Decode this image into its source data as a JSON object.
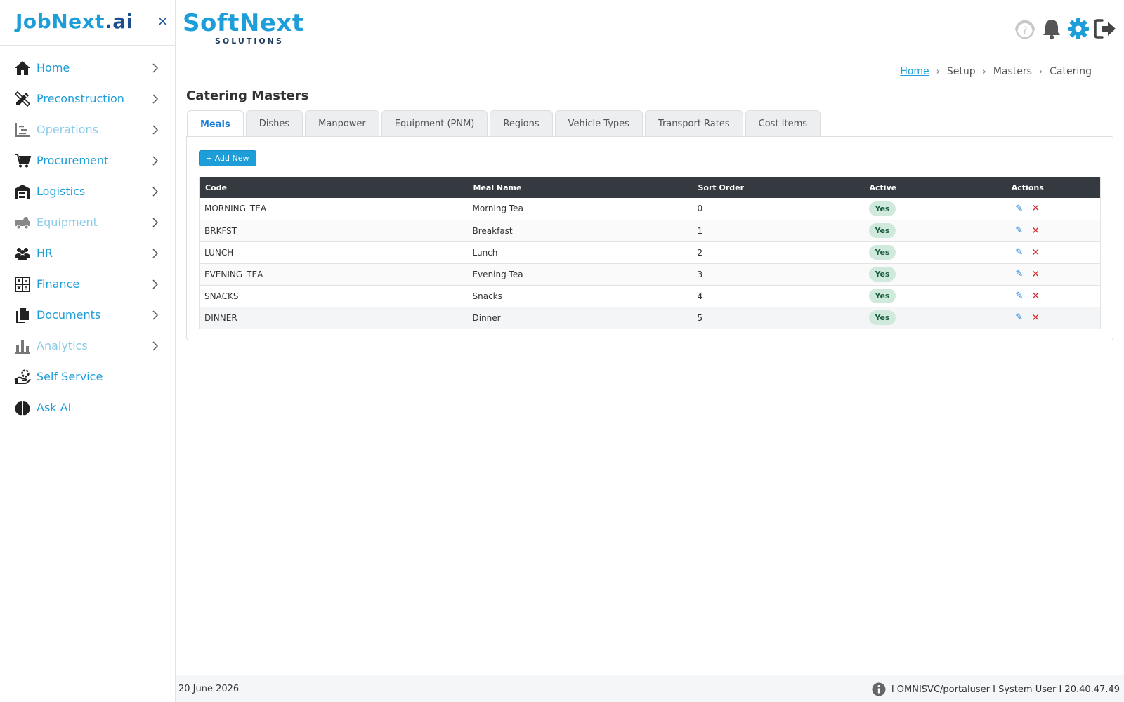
{
  "sidebar": {
    "brand_main": "JobNext",
    "brand_suffix": ".ai",
    "close_glyph": "×",
    "items": [
      {
        "label": "Home",
        "icon": "home-icon",
        "muted": false,
        "chevron": true
      },
      {
        "label": "Preconstruction",
        "icon": "ruler-pencil-icon",
        "muted": false,
        "chevron": true
      },
      {
        "label": "Operations",
        "icon": "operations-chart-icon",
        "muted": true,
        "chevron": true
      },
      {
        "label": "Procurement",
        "icon": "cart-icon",
        "muted": false,
        "chevron": true
      },
      {
        "label": "Logistics",
        "icon": "warehouse-icon",
        "muted": false,
        "chevron": true
      },
      {
        "label": "Equipment",
        "icon": "truck-icon",
        "muted": true,
        "chevron": true
      },
      {
        "label": "HR",
        "icon": "people-icon",
        "muted": false,
        "chevron": true
      },
      {
        "label": "Finance",
        "icon": "calculator-icon",
        "muted": false,
        "chevron": true
      },
      {
        "label": "Documents",
        "icon": "documents-icon",
        "muted": false,
        "chevron": true
      },
      {
        "label": "Analytics",
        "icon": "bar-chart-icon",
        "muted": true,
        "chevron": true
      },
      {
        "label": "Self Service",
        "icon": "hand-gear-icon",
        "muted": false,
        "chevron": false
      },
      {
        "label": "Ask AI",
        "icon": "brain-icon",
        "muted": false,
        "chevron": false
      }
    ]
  },
  "header": {
    "logo_name": "SoftNext",
    "logo_sub": "SOLUTIONS",
    "icons": [
      "help-icon",
      "bell-icon",
      "gear-icon",
      "logout-icon"
    ]
  },
  "breadcrumb": {
    "items": [
      "Home",
      "Setup",
      "Masters",
      "Catering"
    ],
    "separator": "›"
  },
  "page": {
    "title": "Catering Masters"
  },
  "tabs": [
    {
      "label": "Meals",
      "active": true
    },
    {
      "label": "Dishes",
      "active": false
    },
    {
      "label": "Manpower",
      "active": false
    },
    {
      "label": "Equipment (PNM)",
      "active": false
    },
    {
      "label": "Regions",
      "active": false
    },
    {
      "label": "Vehicle Types",
      "active": false
    },
    {
      "label": "Transport Rates",
      "active": false
    },
    {
      "label": "Cost Items",
      "active": false
    }
  ],
  "panel": {
    "add_label": "+ Add New"
  },
  "table": {
    "columns": [
      "Code",
      "Meal Name",
      "Sort Order",
      "Active",
      "Actions"
    ],
    "rows": [
      {
        "code": "MORNING_TEA",
        "name": "Morning Tea",
        "sort": "0",
        "active": "Yes"
      },
      {
        "code": "BRKFST",
        "name": "Breakfast",
        "sort": "1",
        "active": "Yes"
      },
      {
        "code": "LUNCH",
        "name": "Lunch",
        "sort": "2",
        "active": "Yes"
      },
      {
        "code": "EVENING_TEA",
        "name": "Evening Tea",
        "sort": "3",
        "active": "Yes"
      },
      {
        "code": "SNACKS",
        "name": "Snacks",
        "sort": "4",
        "active": "Yes"
      },
      {
        "code": "DINNER",
        "name": "Dinner",
        "sort": "5",
        "active": "Yes"
      }
    ],
    "edit_glyph": "✎",
    "delete_glyph": "✕"
  },
  "footer": {
    "date": "20 June 2026",
    "info": "I OMNISVC/portaluser I System User I 20.40.47.49"
  },
  "colors": {
    "accent": "#1e9ed8",
    "brand_dark": "#1b4e8c",
    "table_header": "#343a40",
    "badge_bg": "#cfe9dd",
    "delete": "#d32f2f"
  }
}
